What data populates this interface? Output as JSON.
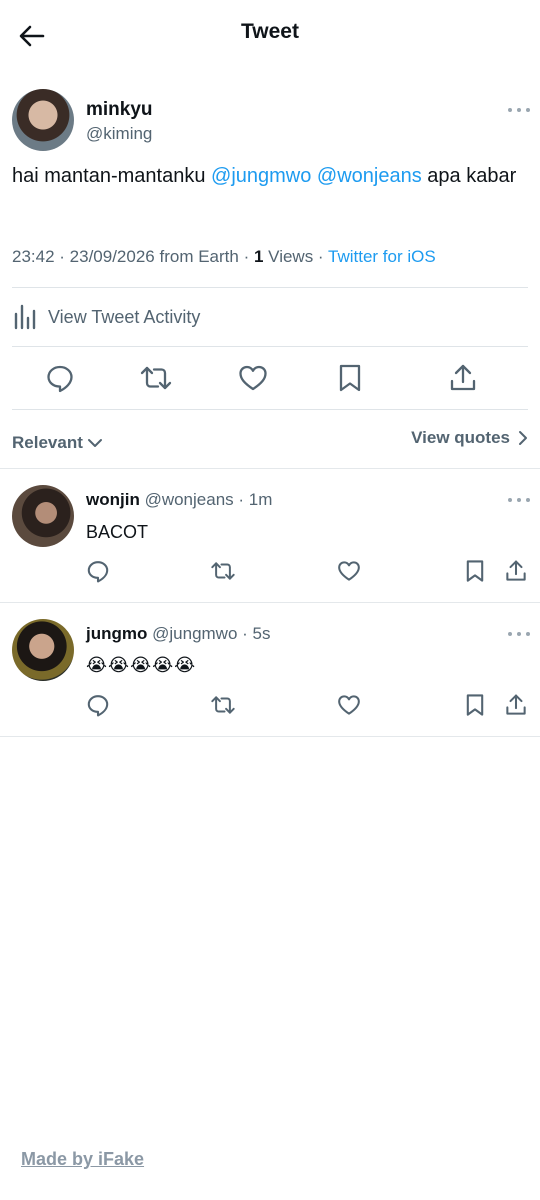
{
  "header": {
    "back_icon": "arrow-left-icon",
    "title": "Tweet"
  },
  "tweet": {
    "author_name": "minkyu",
    "author_handle": "@kiming",
    "text_prefix": "hai mantan-mantanku ",
    "mention_1": "@jungmwo",
    "mention_2": "@wonjeans",
    "text_suffix": " apa kabar",
    "time": "23:42",
    "date": "23/09/2026",
    "from": "from Earth",
    "views_count": "1",
    "views_label": "Views",
    "client": "Twitter for iOS",
    "activity_label": "View Tweet Activity"
  },
  "actions": [
    "reply-icon",
    "retweet-icon",
    "like-icon",
    "bookmark-icon",
    "share-icon"
  ],
  "replies_bar": {
    "sort_label": "Relevant",
    "quotes_label": "View quotes"
  },
  "replies": [
    {
      "name": "wonjin",
      "handle": "@wonjeans",
      "age": "1m",
      "text": "BACOT"
    },
    {
      "name": "jungmo",
      "handle": "@jungmwo",
      "age": "5s",
      "text": "😭😭😭😭😭"
    }
  ],
  "footer": {
    "label": "Made by iFake"
  },
  "colors": {
    "link": "#1d9bf0",
    "secondary_text": "#536471",
    "primary_text": "#0f1419",
    "divider": "#dfe4e8"
  }
}
